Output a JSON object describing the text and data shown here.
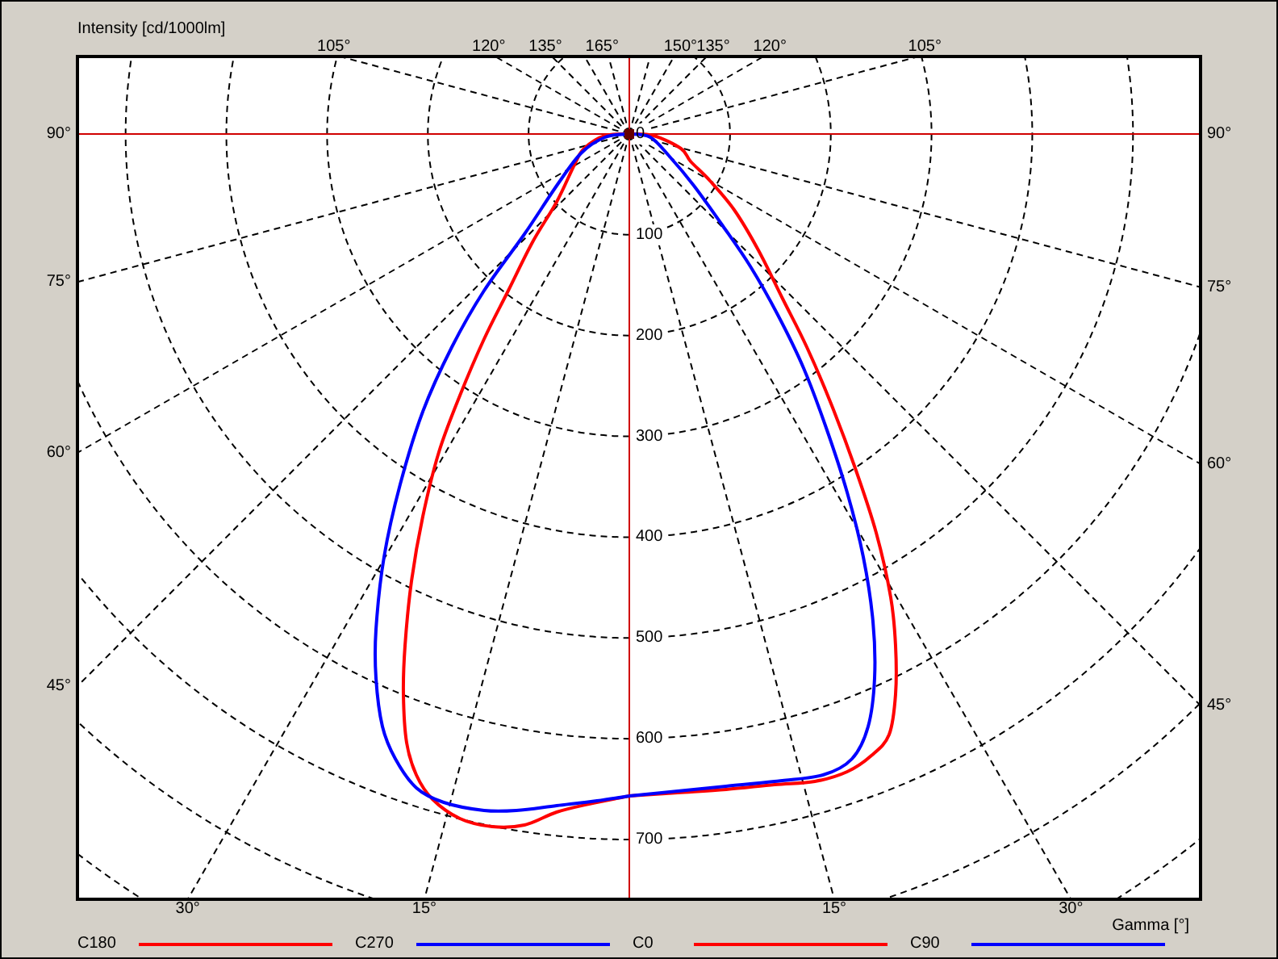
{
  "chart": {
    "ylabel": "Intensity [cd/1000lm]",
    "xlabel": "Gamma [°]",
    "top_angle_labels": [
      "105°",
      "120°",
      "135°",
      "165°",
      "150°",
      "135°",
      "120°",
      "105°"
    ],
    "left_angle_labels": [
      "90°",
      "75°",
      "60°",
      "45°"
    ],
    "right_angle_labels": [
      "90°",
      "75°",
      "60°",
      "45°"
    ],
    "bottom_angle_labels": [
      "30°",
      "15°",
      "15°",
      "30°"
    ],
    "intensity_labels": [
      "0",
      "100",
      "200",
      "300",
      "400",
      "500",
      "600",
      "700"
    ]
  },
  "legend": [
    {
      "label": "C180",
      "color": "#ff0000"
    },
    {
      "label": "C270",
      "color": "#0000ff"
    },
    {
      "label": "C0",
      "color": "#ff0000"
    },
    {
      "label": "C90",
      "color": "#0000ff"
    }
  ]
}
